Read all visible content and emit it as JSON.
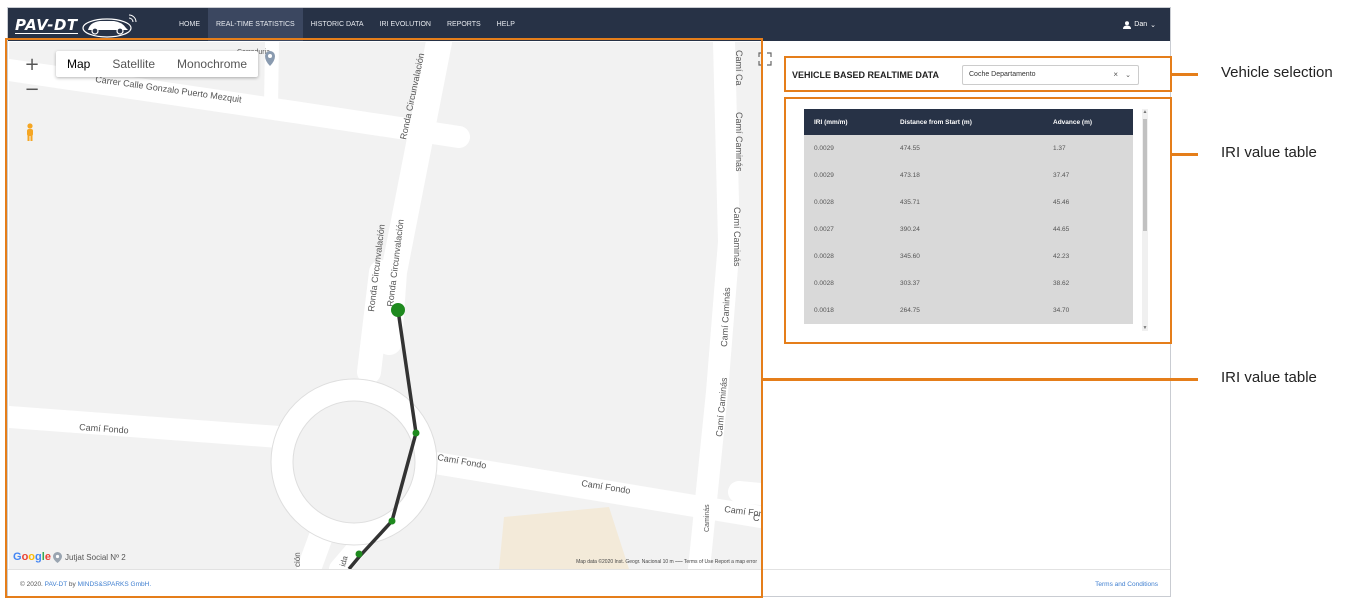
{
  "app": {
    "logo_text": "PAV-DT",
    "nav": [
      {
        "label": "HOME",
        "active": false
      },
      {
        "label": "REAL-TIME STATISTICS",
        "active": true
      },
      {
        "label": "HISTORIC DATA",
        "active": false
      },
      {
        "label": "IRI EVOLUTION",
        "active": false
      },
      {
        "label": "REPORTS",
        "active": false
      },
      {
        "label": "HELP",
        "active": false
      }
    ],
    "user": "Dan",
    "user_chevron": "⌄"
  },
  "map": {
    "types": [
      "Map",
      "Satellite",
      "Monochrome"
    ],
    "active_type": "Map",
    "zoom_in": "+",
    "zoom_out": "−",
    "street_labels": {
      "gonzalo": "Carrer Calle Gonzalo Puerto Mezquit",
      "correduria": "Correduria",
      "ronda1": "Ronda Circunvalación",
      "ronda2": "Ronda Circunvalación",
      "ronda3": "Ronda Circunvalación",
      "cami_c1": "Camí Ca",
      "cami_caminas1": "Camí Caminás",
      "cami_caminas2": "Camí Caminás",
      "cami_caminas3": "Camí Caminás",
      "cami_caminas4": "Camí Caminás",
      "cami_caminas5": "Caminás",
      "fondo1": "Camí Fondo",
      "fondo2": "Camí Fondo",
      "fondo3": "Camí Fondo",
      "fondo4": "Camí Fondo",
      "fondo4_tail": "C",
      "bottom_fragment": "ción",
      "bottom_fragment2": "ida"
    },
    "google": "Google",
    "poi": "Jutjat Social Nº 2",
    "attribution": "Map data ©2020 Inst. Geogr. Nacional   10 m ⎯⎯⎯   Terms of Use   Report a map error"
  },
  "vehicle": {
    "title": "VEHICLE BASED REALTIME DATA",
    "selected": "Coche Departamento",
    "clear": "×",
    "chevron": "⌄"
  },
  "iri_table": {
    "columns": [
      "IRI (mm/m)",
      "Distance from Start (m)",
      "Advance (m)"
    ],
    "rows": [
      [
        "0.0029",
        "474.55",
        "1.37"
      ],
      [
        "0.0029",
        "473.18",
        "37.47"
      ],
      [
        "0.0028",
        "435.71",
        "45.46"
      ],
      [
        "0.0027",
        "390.24",
        "44.65"
      ],
      [
        "0.0028",
        "345.60",
        "42.23"
      ],
      [
        "0.0028",
        "303.37",
        "38.62"
      ],
      [
        "0.0018",
        "264.75",
        "34.70"
      ]
    ]
  },
  "footer": {
    "copyright_prefix": "© 2020. ",
    "brand_link": "PAV-DT",
    "by": " by ",
    "company_link": "MINDS&SPARKS GmbH.",
    "terms": "Terms and Conditions"
  },
  "annotations": {
    "vehicle_selection": "Vehicle selection",
    "iri_table_1": "IRI value table",
    "iri_table_2": "IRI value table"
  },
  "colors": {
    "navbar": "#273246",
    "highlight": "#e57e1a",
    "route": "#333333",
    "route_points": "#1f8a1f",
    "table_header": "#273246",
    "table_body": "#d9d9d9"
  }
}
